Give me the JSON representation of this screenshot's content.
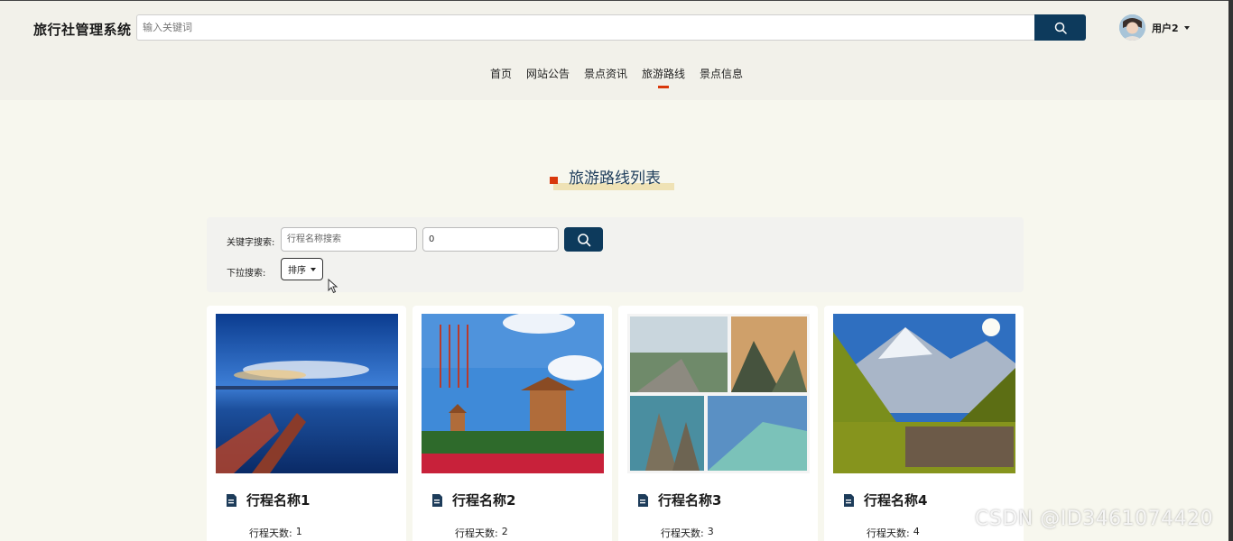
{
  "header": {
    "brand": "旅行社管理系统",
    "search_placeholder": "输入关键词",
    "user_name": "用户2"
  },
  "nav": {
    "items": [
      {
        "label": "首页",
        "active": false
      },
      {
        "label": "网站公告",
        "active": false
      },
      {
        "label": "景点资讯",
        "active": false
      },
      {
        "label": "旅游路线",
        "active": true
      },
      {
        "label": "景点信息",
        "active": false
      }
    ]
  },
  "main": {
    "title": "旅游路线列表",
    "filter": {
      "keyword_label": "关键字搜索:",
      "keyword_placeholder": "行程名称搜索",
      "days_value": "0",
      "dropdown_label": "下拉搜索:",
      "sort_label": "排序"
    },
    "cards": [
      {
        "title": "行程名称1",
        "days_label": "行程天数:",
        "days": "1",
        "image": "lake-sunset-boat"
      },
      {
        "title": "行程名称2",
        "days_label": "行程天数:",
        "days": "2",
        "image": "pagoda-calligraphy"
      },
      {
        "title": "行程名称3",
        "days_label": "行程天数:",
        "days": "3",
        "image": "mountain-collage"
      },
      {
        "title": "行程名称4",
        "days_label": "行程天数:",
        "days": "4",
        "image": "alpine-valley-village"
      }
    ]
  },
  "watermark": "CSDN @ID3461074420",
  "colors": {
    "primary": "#0d3a5c",
    "accent": "#d9380b",
    "page_bg": "#f7f7ee",
    "header_bg": "#f2f1ea"
  }
}
